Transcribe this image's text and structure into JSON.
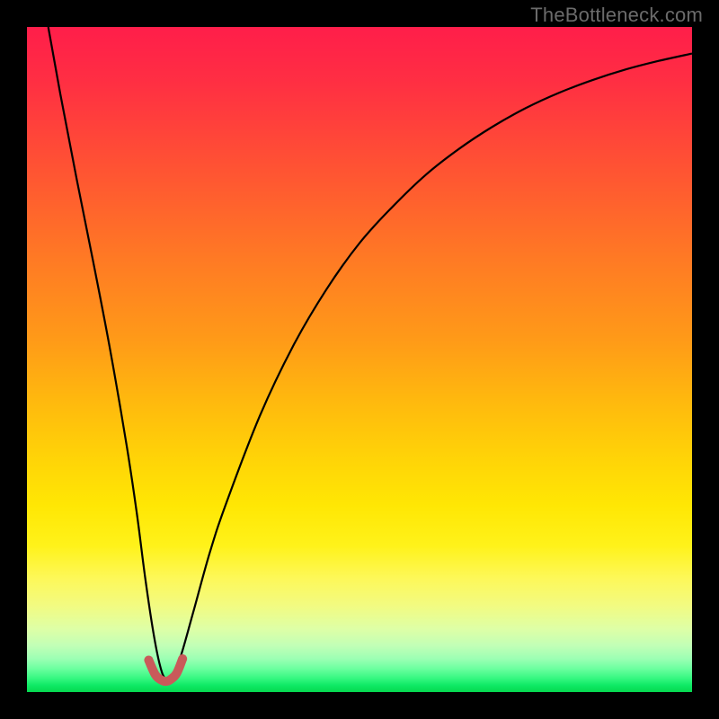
{
  "watermark": "TheBottleneck.com",
  "chart_data": {
    "type": "line",
    "title": "",
    "xlabel": "",
    "ylabel": "",
    "xlim": [
      0,
      100
    ],
    "ylim": [
      0,
      100
    ],
    "series": [
      {
        "name": "bottleneck-curve",
        "x": [
          3.2,
          5,
          7.5,
          10,
          12.5,
          15,
          16.5,
          17.8,
          19,
          20,
          20.8,
          21.7,
          23,
          25,
          27.5,
          30,
          35,
          40,
          45,
          50,
          55,
          60,
          65,
          70,
          75,
          80,
          85,
          90,
          95,
          100
        ],
        "y": [
          100,
          90,
          77,
          64.5,
          51.5,
          37,
          27,
          17,
          9,
          4,
          2,
          2.2,
          5,
          12,
          21,
          28.5,
          41.5,
          52,
          60.5,
          67.5,
          73,
          77.8,
          81.7,
          85,
          87.8,
          90.1,
          92,
          93.6,
          94.9,
          96
        ]
      }
    ],
    "highlight": {
      "name": "optimal-region",
      "x": [
        18.3,
        19.3,
        20.2,
        20.9,
        21.6,
        22.5,
        23.4
      ],
      "y": [
        4.8,
        2.6,
        1.8,
        1.6,
        1.9,
        2.8,
        5.0
      ]
    },
    "background_gradient": {
      "top": "#ff1e4a",
      "mid": "#ffe000",
      "bottom": "#06d94f"
    },
    "annotations": []
  }
}
